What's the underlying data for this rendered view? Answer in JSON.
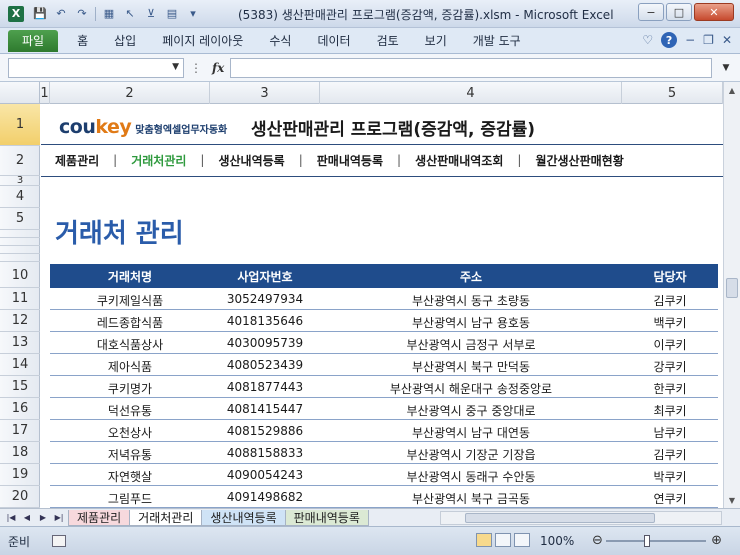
{
  "window": {
    "title": "(5383) 생산판매관리 프로그램(증감액, 증감률).xlsm - Microsoft Excel",
    "buttons": {
      "minimize": "−",
      "maximize": "□",
      "close": "✕"
    }
  },
  "ribbon": {
    "tabs": [
      "파일",
      "홈",
      "삽입",
      "페이지 레이아웃",
      "수식",
      "데이터",
      "검토",
      "보기",
      "개발 도구"
    ]
  },
  "formula_bar": {
    "name_box": "",
    "fx": "fx",
    "value": ""
  },
  "columns": [
    {
      "label": "1"
    },
    {
      "label": "2"
    },
    {
      "label": "3"
    },
    {
      "label": "4"
    },
    {
      "label": "5"
    }
  ],
  "rows": [
    "1",
    "2",
    "3",
    "4",
    "5",
    "",
    "",
    "",
    "10",
    "11",
    "12",
    "13",
    "14",
    "15",
    "16",
    "17",
    "18",
    "19",
    "20"
  ],
  "brand": {
    "co": "cou",
    "key": "key",
    "tagline": "맞춤형엑셀업무자동화"
  },
  "program_title": "생산판매관리 프로그램(증감액, 증감률)",
  "menu": {
    "items": [
      "제품관리",
      "거래처관리",
      "생산내역등록",
      "판매내역등록",
      "생산판매내역조회",
      "월간생산판매현황"
    ],
    "separator": "|",
    "active": "거래처관리"
  },
  "page_title": "거래처 관리",
  "table": {
    "headers": [
      "거래처명",
      "사업자번호",
      "주소",
      "담당자"
    ],
    "rows": [
      [
        "쿠키제일식품",
        "3052497934",
        "부산광역시 동구 초량동",
        "김쿠키"
      ],
      [
        "레드종합식품",
        "4018135646",
        "부산광역시 남구 용호동",
        "백쿠키"
      ],
      [
        "대호식품상사",
        "4030095739",
        "부산광역시 금정구 서부로",
        "이쿠키"
      ],
      [
        "제아식품",
        "4080523439",
        "부산광역시 북구 만덕동",
        "강쿠키"
      ],
      [
        "쿠키명가",
        "4081877443",
        "부산광역시 해운대구 송정중앙로",
        "한쿠키"
      ],
      [
        "덕선유통",
        "4081415447",
        "부산광역시 중구 중앙대로",
        "최쿠키"
      ],
      [
        "오천상사",
        "4081529886",
        "부산광역시 남구 대연동",
        "남쿠키"
      ],
      [
        "저녁유통",
        "4088158833",
        "부산광역시 기장군 기장읍",
        "김쿠키"
      ],
      [
        "자연햇살",
        "4090054243",
        "부산광역시 동래구 수안동",
        "박쿠키"
      ],
      [
        "그림푸드",
        "4091498682",
        "부산광역시 북구 금곡동",
        "연쿠키"
      ]
    ]
  },
  "sheet_tabs": [
    "제품관리",
    "거래처관리",
    "생산내역등록",
    "판매내역등록"
  ],
  "status": {
    "text": "준비",
    "zoom": "100%"
  }
}
